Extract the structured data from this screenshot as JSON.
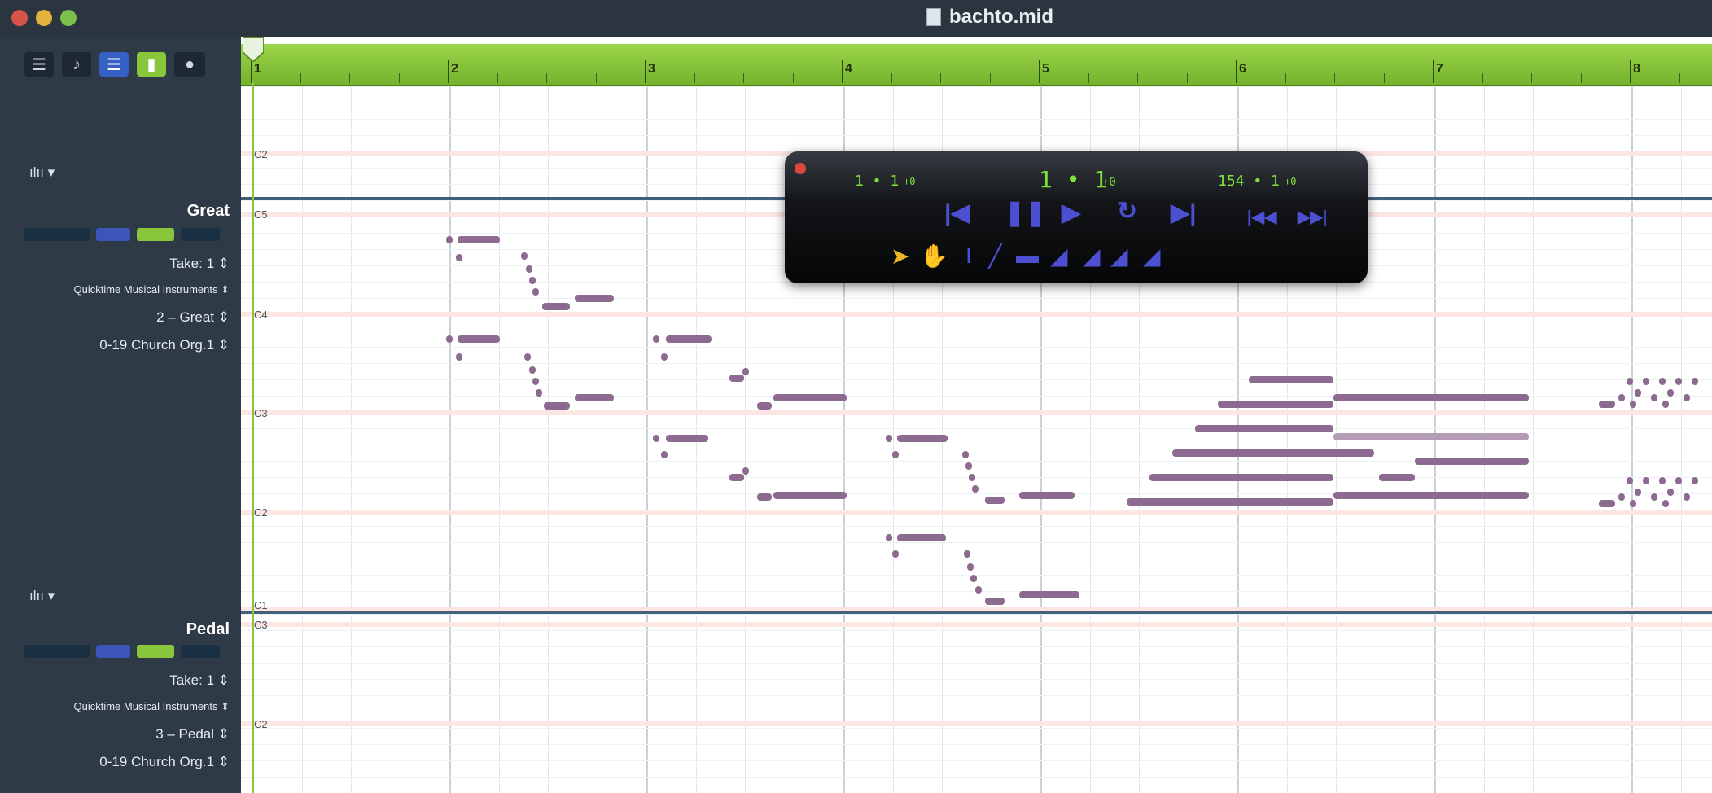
{
  "window": {
    "title": "bachto.mid"
  },
  "toolbar": {
    "buttons": [
      {
        "name": "mixer-view-icon",
        "glyph": "☰"
      },
      {
        "name": "notation-view-icon",
        "glyph": "♪"
      },
      {
        "name": "piano-roll-view-icon",
        "glyph": "☰"
      },
      {
        "name": "loop-icon",
        "glyph": "▮"
      },
      {
        "name": "record-icon",
        "glyph": "●"
      }
    ]
  },
  "ruler": {
    "bars": [
      "1",
      "2",
      "3",
      "4",
      "5",
      "6",
      "7",
      "8"
    ]
  },
  "tracks": [
    {
      "name": "Great",
      "take": "Take: 1 ⇕",
      "device": "Quicktime Musical Instruments ⇕",
      "channel": "2 – Great ⇕",
      "instrument": "0-19 Church Org.1 ⇕"
    },
    {
      "name": "Pedal",
      "take": "Take: 1 ⇕",
      "device": "Quicktime Musical Instruments ⇕",
      "channel": "3 – Pedal ⇕",
      "instrument": "0-19 Church Org.1 ⇕"
    }
  ],
  "view_menus": [
    {
      "label": "ılıı ▾"
    },
    {
      "label": "ılıı ▾"
    }
  ],
  "pitch_labels": {
    "top_pane": [
      "C2"
    ],
    "great_pane": [
      "C5",
      "C4",
      "C3",
      "C2",
      "C1"
    ],
    "pedal_pane": [
      "C3",
      "C2"
    ]
  },
  "transport": {
    "position_left": "1 • 1",
    "position_left_tick": "+0",
    "position_main": "1 • 1",
    "position_main_tick": "+0",
    "position_right": "154 • 1",
    "position_right_tick": "+0",
    "buttons": [
      {
        "name": "rewind-to-start-icon",
        "glyph": "|◀"
      },
      {
        "name": "pause-icon",
        "glyph": "❚❚"
      },
      {
        "name": "play-icon",
        "glyph": "▶"
      },
      {
        "name": "loop-toggle-icon",
        "glyph": "↻"
      },
      {
        "name": "skip-to-end-icon",
        "glyph": "▶|"
      },
      {
        "name": "rewind-icon",
        "glyph": "|◀◀"
      },
      {
        "name": "fast-forward-icon",
        "glyph": "▶▶|"
      }
    ],
    "tools": [
      {
        "name": "pointer-tool-icon",
        "glyph": "➤"
      },
      {
        "name": "hand-tool-icon",
        "glyph": "✋"
      },
      {
        "name": "text-cursor-tool-icon",
        "glyph": "I"
      },
      {
        "name": "line-tool-icon",
        "glyph": "╱"
      },
      {
        "name": "flat-shape-tool-icon",
        "glyph": "▬"
      },
      {
        "name": "ramp-tool-icon",
        "glyph": "◢"
      },
      {
        "name": "ramp-up-tool-icon",
        "glyph": "◢"
      },
      {
        "name": "steep-ramp-tool-icon",
        "glyph": "◢"
      },
      {
        "name": "shallow-ramp-tool-icon",
        "glyph": "◢"
      }
    ]
  },
  "colors": {
    "ruler": "#8ac63c",
    "note": "#8d6a8f",
    "sidebar": "#2e3a45",
    "transport_digits": "#7fe33a",
    "transport_buttons": "#4b4fd0"
  }
}
